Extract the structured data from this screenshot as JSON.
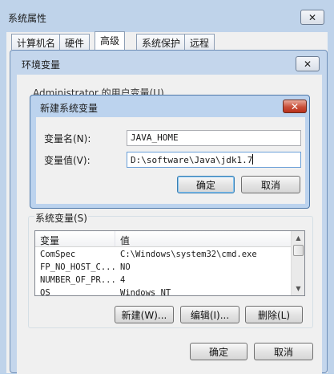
{
  "system_props": {
    "title": "系统属性",
    "close": "✕",
    "tabs": [
      "计算机名",
      "硬件",
      "高级",
      "系统保护",
      "远程"
    ]
  },
  "env_vars": {
    "title": "环境变量",
    "close": "✕",
    "user_section_label": "Administrator 的用户变量(U)",
    "system_section_label": "系统变量(S)",
    "table": {
      "columns": [
        "变量",
        "值"
      ],
      "rows": [
        {
          "name": "ComSpec",
          "value": "C:\\Windows\\system32\\cmd.exe"
        },
        {
          "name": "FP_NO_HOST_C...",
          "value": "NO"
        },
        {
          "name": "NUMBER_OF_PR...",
          "value": "4"
        },
        {
          "name": "OS",
          "value": "Windows_NT"
        }
      ]
    },
    "new_button": "新建(W)...",
    "edit_button": "编辑(I)...",
    "delete_button": "删除(L)",
    "ok_button": "确定",
    "cancel_button": "取消"
  },
  "new_var_dialog": {
    "title": "新建系统变量",
    "close": "✕",
    "name_label": "变量名(N):",
    "name_value": "JAVA_HOME",
    "value_label": "变量值(V):",
    "value_value": "D:\\software\\Java\\jdk1.7",
    "ok_button": "确定",
    "cancel_button": "取消"
  }
}
